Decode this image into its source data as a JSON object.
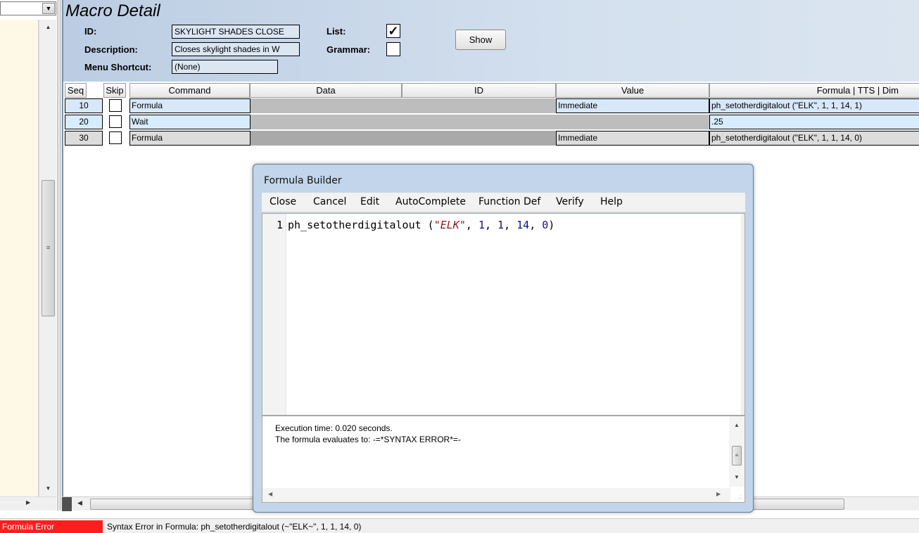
{
  "header": {
    "title": "Macro Detail",
    "id_label": "ID:",
    "id_value": "SKYLIGHT SHADES CLOSE",
    "description_label": "Description:",
    "description_value": "Closes skylight shades in W",
    "menu_shortcut_label": "Menu Shortcut:",
    "menu_shortcut_value": "(None)",
    "list_label": "List:",
    "list_checked": true,
    "grammar_label": "Grammar:",
    "grammar_checked": false,
    "show_button": "Show"
  },
  "grid": {
    "columns": [
      "Seq",
      "Skip",
      "Command",
      "Data",
      "ID",
      "Value",
      "Formula | TTS | Dim"
    ],
    "rows": [
      {
        "seq": "10",
        "skip": false,
        "command": "Formula",
        "data": "",
        "id": "",
        "value": "Immediate",
        "formula": "ph_setotherdigitalout (\"ELK\", 1, 1, 14, 1)"
      },
      {
        "seq": "20",
        "skip": false,
        "command": "Wait",
        "data": "",
        "id": "",
        "value": "",
        "formula": ".25"
      },
      {
        "seq": "30",
        "skip": false,
        "command": "Formula",
        "data": "",
        "id": "",
        "value": "Immediate",
        "formula": "ph_setotherdigitalout (\"ELK\", 1, 1, 14, 0)"
      }
    ]
  },
  "dialog": {
    "title": "Formula Builder",
    "menu": [
      "Close",
      "Cancel",
      "Edit",
      "AutoComplete",
      "Function Def",
      "Verify",
      "Help"
    ],
    "editor": {
      "line_number": "1",
      "code_fn": "ph_setotherdigitalout (",
      "code_str": "\"ELK\"",
      "code_sep1": ", ",
      "code_n1": "1",
      "code_sep2": ", ",
      "code_n2": "1",
      "code_sep3": ", ",
      "code_n3": "14",
      "code_sep4": ", ",
      "code_n4": "0",
      "code_close": ")"
    },
    "output": {
      "line1": "Execution time: 0.020 seconds.",
      "line2": "The formula evaluates to: -=*SYNTAX ERROR*=-"
    }
  },
  "status": {
    "badge": "Formula Error",
    "badge_color": "#ff1e1e",
    "message": "Syntax Error in Formula: ph_setotherdigitalout (~\"ELK~\", 1, 1, 14, 0)"
  }
}
